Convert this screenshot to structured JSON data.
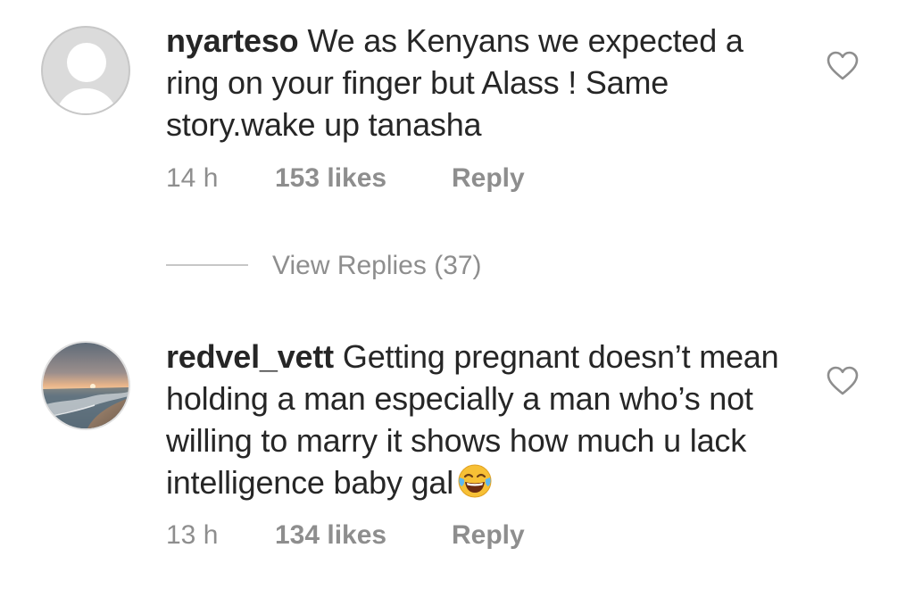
{
  "comments": [
    {
      "username": "nyarteso",
      "text": "We as Kenyans we expected a ring on your finger but Alass ! Same story.wake up tanasha",
      "time": "14 h",
      "likes": "153 likes",
      "reply_label": "Reply",
      "avatar": "default-user-avatar",
      "liked": false
    },
    {
      "username": "redvel_vett",
      "text": "Getting pregnant doesn’t mean holding a man especially a man who’s not willing to marry it shows how much u lack intelligence baby gal",
      "emoji": "face-with-tears-of-joy",
      "time": "13 h",
      "likes": "134 likes",
      "reply_label": "Reply",
      "avatar": "beach-sunset-avatar",
      "liked": false
    }
  ],
  "view_replies": {
    "label": "View Replies (37)"
  },
  "colors": {
    "text": "#262626",
    "meta": "#8e8e8e",
    "divider": "#c7c7c7",
    "background": "#ffffff"
  }
}
